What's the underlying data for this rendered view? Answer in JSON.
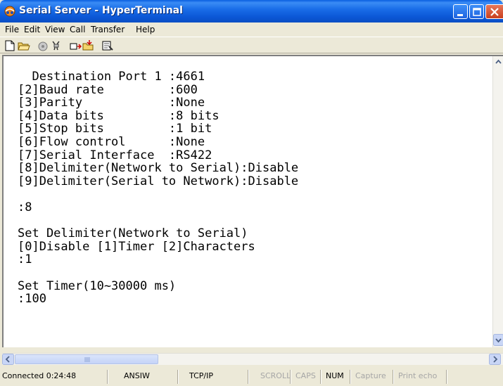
{
  "window": {
    "title": "Serial Server - HyperTerminal",
    "icons": {
      "app": "hyperterminal-app-icon",
      "minimize": "minimize-icon",
      "maximize": "maximize-icon",
      "close": "close-icon"
    }
  },
  "menubar": {
    "items": [
      "File",
      "Edit",
      "View",
      "Call",
      "Transfer",
      "Help"
    ]
  },
  "toolbar": {
    "icons": [
      "new-connection-icon",
      "open-icon",
      "connect-icon",
      "disconnect-icon",
      "send-icon",
      "receive-icon",
      "properties-icon"
    ]
  },
  "terminal": {
    "lines": [
      "  Destination Port 1 :4661",
      "[2]Baud rate         :600",
      "[3]Parity            :None",
      "[4]Data bits         :8 bits",
      "[5]Stop bits         :1 bit",
      "[6]Flow control      :None",
      "[7]Serial Interface  :RS422",
      "[8]Delimiter(Network to Serial):Disable",
      "[9]Delimiter(Serial to Network):Disable",
      "",
      ":8",
      "",
      "Set Delimiter(Network to Serial)",
      "[0]Disable [1]Timer [2]Characters",
      ":1",
      "",
      "Set Timer(10~30000 ms)",
      ":100"
    ]
  },
  "statusbar": {
    "connected": "Connected 0:24:48",
    "emulation": "ANSIW",
    "protocol": "TCP/IP",
    "scroll": "SCROLL",
    "caps": "CAPS",
    "num": "NUM",
    "capture": "Capture",
    "print_echo": "Print echo"
  },
  "colors": {
    "titlebar": "#0b57d6",
    "chrome": "#ece9d8",
    "terminal_bg": "#ffffff",
    "terminal_text": "#000000",
    "dim_status": "#a6a6a6"
  }
}
